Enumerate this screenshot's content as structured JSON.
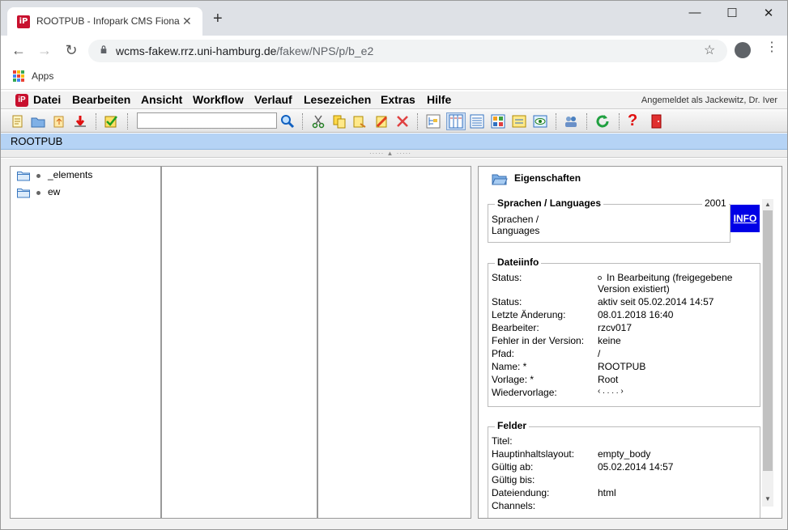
{
  "browser": {
    "tab_title": "ROOTPUB - Infopark CMS Fiona",
    "tab_close": "✕",
    "new_tab": "+",
    "url_host": "wcms-fakew.rrz.uni-hamburg.de",
    "url_path": "/fakew/NPS/p/b_e2",
    "bookmark_apps": "Apps",
    "window_controls": {
      "minimize": "—",
      "maximize": "☐",
      "close": "✕"
    }
  },
  "menubar": {
    "items": [
      "Datei",
      "Bearbeiten",
      "Ansicht",
      "Workflow",
      "Verlauf",
      "Lesezeichen",
      "Extras",
      "Hilfe"
    ],
    "login": "Angemeldet als Jackewitz, Dr. Iver"
  },
  "toolbar": {
    "search_value": ""
  },
  "breadcrumb": "ROOTPUB",
  "tree": {
    "items": [
      "_elements",
      "ew"
    ]
  },
  "properties": {
    "title": "Eigenschaften",
    "languages": {
      "legend": "Sprachen / Languages",
      "year": "2001",
      "text_line1": "Sprachen /",
      "text_line2": "Languages",
      "info_label": "INFO"
    },
    "fileinfo": {
      "legend": "Dateiinfo",
      "rows": [
        {
          "key": "Status:",
          "value": "In Bearbeitung (freigegebene",
          "value2": "Version existiert)"
        },
        {
          "key": "Status:",
          "value": "aktiv seit 05.02.2014 14:57"
        },
        {
          "key": "Letzte Änderung:",
          "value": "08.01.2018 16:40"
        },
        {
          "key": "Bearbeiter:",
          "value": "rzcv017"
        },
        {
          "key": "Fehler in der Version:",
          "value": "keine"
        },
        {
          "key": "Pfad:",
          "value": "/"
        },
        {
          "key": "Name: *",
          "value": "ROOTPUB"
        },
        {
          "key": "Vorlage: *",
          "value": "Root"
        },
        {
          "key": "Wiedervorlage:",
          "value": "‹ . . . . ›"
        }
      ]
    },
    "fields": {
      "legend": "Felder",
      "rows": [
        {
          "key": "Titel:",
          "value": ""
        },
        {
          "key": "Hauptinhaltslayout:",
          "value": "empty_body"
        },
        {
          "key": "Gültig ab:",
          "value": "05.02.2014 14:57"
        },
        {
          "key": "Gültig bis:",
          "value": ""
        },
        {
          "key": "Dateiendung:",
          "value": "html"
        },
        {
          "key": "Channels:",
          "value": ""
        }
      ]
    }
  },
  "colors": {
    "brand_red": "#c8102e",
    "crumb_blue": "#b5d3f5",
    "info_blue": "#0000e6"
  }
}
